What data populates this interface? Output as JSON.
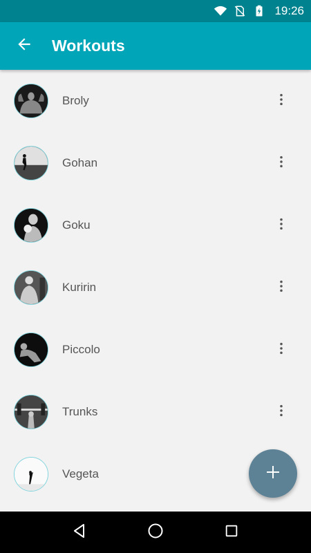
{
  "status_bar": {
    "time": "19:26",
    "icons": [
      "wifi-icon",
      "no-sim-icon",
      "battery-charging-icon"
    ]
  },
  "app_bar": {
    "title": "Workouts",
    "back_icon": "arrow-back-icon"
  },
  "workouts": [
    {
      "name": "Broly",
      "avatar": "bodybuilder-back-photo"
    },
    {
      "name": "Gohan",
      "avatar": "runner-silhouette-photo"
    },
    {
      "name": "Goku",
      "avatar": "boxer-photo"
    },
    {
      "name": "Kuririn",
      "avatar": "muscular-man-photo"
    },
    {
      "name": "Piccolo",
      "avatar": "crouching-athlete-photo"
    },
    {
      "name": "Trunks",
      "avatar": "barbell-lift-photo"
    },
    {
      "name": "Vegeta",
      "avatar": "high-kick-silhouette-photo"
    }
  ],
  "fab": {
    "icon": "plus-icon"
  },
  "nav_bar": {
    "icons": [
      "back-triangle-icon",
      "home-circle-icon",
      "recents-square-icon"
    ]
  },
  "colors": {
    "status_bar": "#00838f",
    "app_bar": "#00a5b8",
    "background": "#f2f2f2",
    "fab": "#5d8295",
    "avatar_border": "#7fd3dc"
  }
}
